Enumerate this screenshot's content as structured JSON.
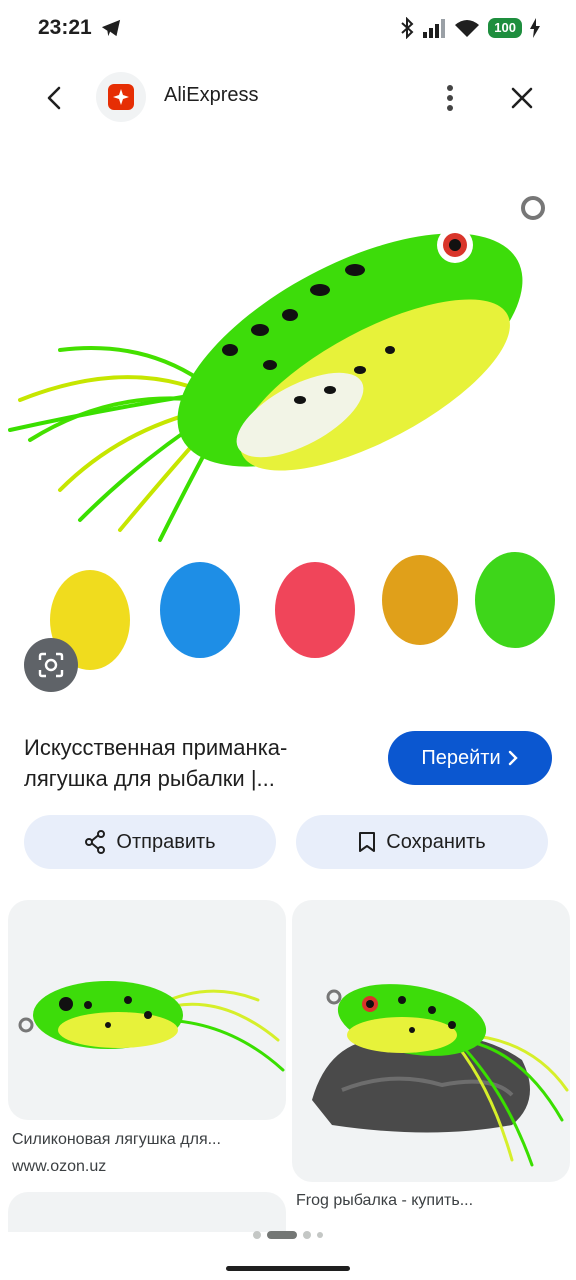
{
  "status": {
    "time": "23:21",
    "battery": "100"
  },
  "header": {
    "site_name": "AliExpress"
  },
  "result": {
    "title": "Искусственная приманка-лягушка для рыбалки |...",
    "go_label": "Перейти",
    "share_label": "Отправить",
    "save_label": "Сохранить"
  },
  "related": [
    {
      "title": "Силиконовая лягушка для...",
      "source": "www.ozon.uz"
    },
    {
      "title": "Frog рыбалка - купить..."
    }
  ],
  "colors": {
    "accent": "#0b57d0",
    "pill": "#e8eefa",
    "aliexpress_red": "#e62e04"
  }
}
